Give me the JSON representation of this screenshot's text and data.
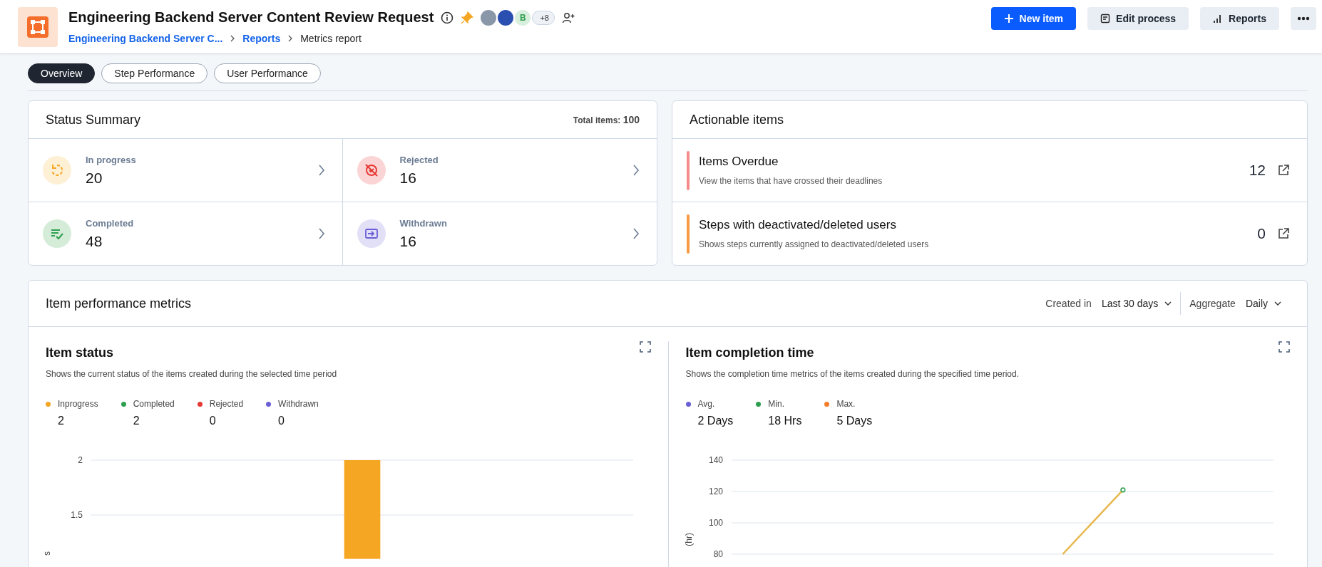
{
  "header": {
    "title": "Engineering Backend Server Content Review Request",
    "breadcrumbs": [
      {
        "label": "Engineering Backend Server C...",
        "current": false
      },
      {
        "label": "Reports",
        "current": false
      },
      {
        "label": "Metrics report",
        "current": true
      }
    ],
    "avatars": {
      "initials": "B",
      "more": "+8"
    },
    "buttons": [
      {
        "label": "New item",
        "kind": "primary"
      },
      {
        "label": "Edit process",
        "kind": "edit"
      },
      {
        "label": "Reports",
        "kind": "reports"
      }
    ]
  },
  "tabs": [
    {
      "label": "Overview",
      "selected": true
    },
    {
      "label": "Step Performance",
      "selected": false
    },
    {
      "label": "User Performance",
      "selected": false
    }
  ],
  "status_summary": {
    "title": "Status Summary",
    "total_label": "Total items:",
    "total": "100",
    "items": [
      {
        "label": "In progress",
        "count": "20",
        "kind": "in_progress"
      },
      {
        "label": "Rejected",
        "count": "16",
        "kind": "rejected"
      },
      {
        "label": "Completed",
        "count": "48",
        "kind": "completed"
      },
      {
        "label": "Withdrawn",
        "count": "16",
        "kind": "withdrawn"
      }
    ]
  },
  "actionable": {
    "title": "Actionable items",
    "items": [
      {
        "title": "Items Overdue",
        "description": "View the items that have crossed their deadlines",
        "count": "12",
        "color": "#f58c8c"
      },
      {
        "title": "Steps with deactivated/deleted users",
        "description": "Shows steps currently assigned to deactivated/deleted users",
        "count": "0",
        "color": "#f79a45"
      }
    ]
  },
  "metrics": {
    "title": "Item performance metrics",
    "filters": [
      {
        "label": "Created in",
        "value": "Last 30 days"
      },
      {
        "label": "Aggregate",
        "value": "Daily"
      }
    ],
    "panels": [
      {
        "title": "Item status",
        "description": "Shows the current status of the items created during the selected time period",
        "legend": [
          {
            "label": "Inprogress",
            "value": "2",
            "color": "#f5a623"
          },
          {
            "label": "Completed",
            "value": "2",
            "color": "#2e9e4f"
          },
          {
            "label": "Rejected",
            "value": "0",
            "color": "#e53935"
          },
          {
            "label": "Withdrawn",
            "value": "0",
            "color": "#6a5fd6"
          }
        ],
        "chart_data": {
          "type": "bar",
          "ylabel": "s",
          "ylim": [
            1.1,
            2
          ],
          "yticks": [
            1.5,
            2
          ],
          "series": [
            {
              "color": "#f5a623",
              "values": [
                null,
                null,
                null,
                null,
                2,
                null,
                null,
                null,
                null
              ]
            }
          ]
        }
      },
      {
        "title": "Item completion time",
        "description": "Shows the completion time metrics of the items created during the specified time period.",
        "legend": [
          {
            "label": "Avg.",
            "value": "2 Days",
            "color": "#6a5fd6"
          },
          {
            "label": "Min.",
            "value": "18 Hrs",
            "color": "#2e9e4f"
          },
          {
            "label": "Max.",
            "value": "5 Days",
            "color": "#f57c2b"
          }
        ],
        "chart_data": {
          "type": "line",
          "ylabel": "(hr)",
          "ylim": [
            80,
            140
          ],
          "yticks": [
            80,
            100,
            120,
            140
          ],
          "series": [
            {
              "color": "#e8b84f",
              "values": [
                null,
                null,
                null,
                null,
                null,
                80,
                121,
                null,
                null
              ]
            }
          ]
        }
      }
    ]
  }
}
